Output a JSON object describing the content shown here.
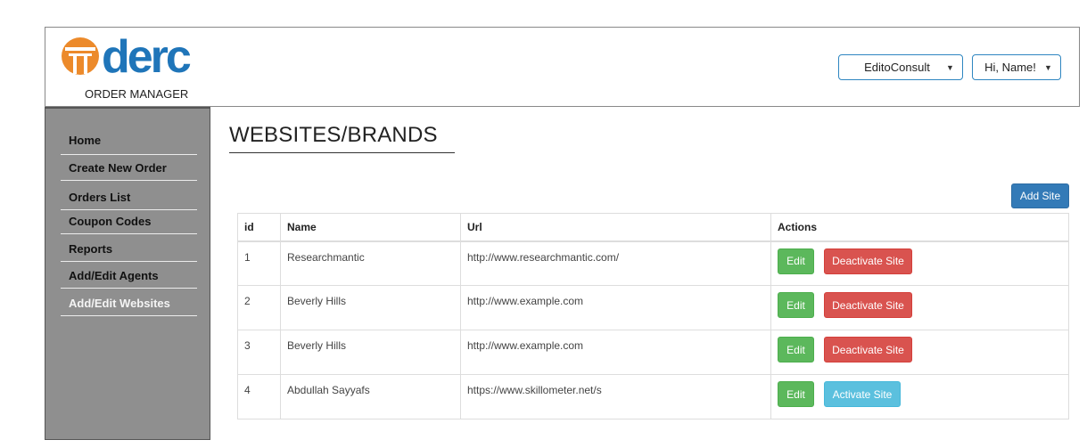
{
  "brand": {
    "logo_text": "derc",
    "subtitle": "ORDER MANAGER",
    "colors": {
      "orange": "#ec8a2b",
      "blue": "#1f75b9"
    }
  },
  "header": {
    "company_select": "EditoConsult",
    "user_menu": "Hi, Name!",
    "caret_icon": "▼"
  },
  "sidebar": {
    "items": [
      {
        "label": "Home",
        "active": false
      },
      {
        "label": "Create New Order",
        "active": false
      },
      {
        "label": "Orders List",
        "active": false
      },
      {
        "label": "Coupon Codes",
        "active": false
      },
      {
        "label": "Reports",
        "active": false
      },
      {
        "label": "Add/Edit Agents",
        "active": false
      },
      {
        "label": "Add/Edit Websites",
        "active": true
      }
    ]
  },
  "main": {
    "title": "WEBSITES/BRANDS",
    "add_button": "Add Site",
    "table": {
      "columns": [
        "id",
        "Name",
        "Url",
        "Actions"
      ],
      "rows": [
        {
          "id": "1",
          "name": "Researchmantic",
          "url": "http://www.researchmantic.com/",
          "edit": "Edit",
          "toggle": "Deactivate Site"
        },
        {
          "id": "2",
          "name": "Beverly Hills",
          "url": "http://www.example.com",
          "edit": "Edit",
          "toggle": "Deactivate Site"
        },
        {
          "id": "3",
          "name": "Beverly Hills",
          "url": "http://www.example.com",
          "edit": "Edit",
          "toggle": "Deactivate Site"
        },
        {
          "id": "4",
          "name": "Abdullah Sayyafs",
          "url": "https://www.skillometer.net/s",
          "edit": "Edit",
          "toggle": "Activate Site"
        }
      ]
    }
  }
}
